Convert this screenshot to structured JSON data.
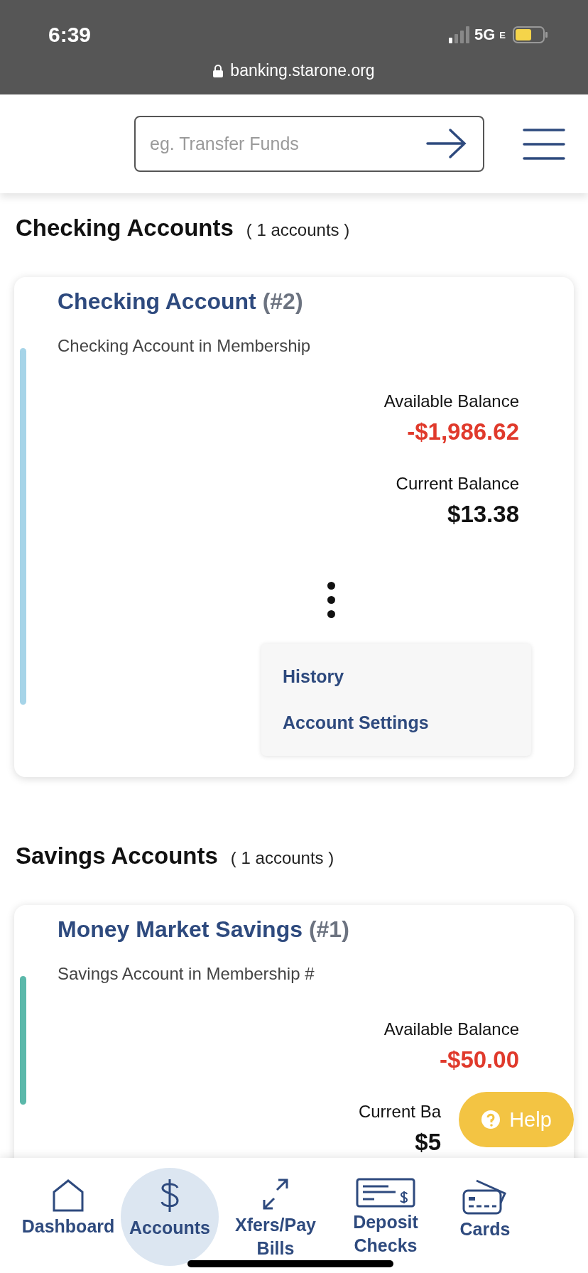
{
  "status_bar": {
    "time": "6:39",
    "network": "5G",
    "network_suffix": "E"
  },
  "browser": {
    "url": "banking.starone.org"
  },
  "header": {
    "search": {
      "placeholder": "eg. Transfer Funds"
    }
  },
  "sections": [
    {
      "title": "Checking Accounts",
      "count": "( 1 accounts )",
      "cards": [
        {
          "title": "Checking Account",
          "number": "(#2)",
          "subtitle": "Checking Account in Membership",
          "color": "#a6d4e8",
          "balances": [
            {
              "label": "Available Balance",
              "amount": "-$1,986.62",
              "negative": true
            },
            {
              "label": "Current Balance",
              "amount": "$13.38",
              "negative": false
            }
          ],
          "menu": {
            "open": true,
            "items": [
              "History",
              "Account Settings"
            ]
          }
        }
      ]
    },
    {
      "title": "Savings Accounts",
      "count": "( 1 accounts )",
      "cards": [
        {
          "title": "Money Market Savings",
          "number": "(#1)",
          "subtitle": "Savings Account in Membership #",
          "color": "#5bb8aa",
          "balances": [
            {
              "label": "Available Balance",
              "amount": "-$50.00",
              "negative": true
            },
            {
              "label": "Current Ba",
              "amount": "$5",
              "negative": false
            }
          ]
        }
      ]
    }
  ],
  "help_button": {
    "label": "Help"
  },
  "bottom_nav": [
    {
      "kind": "home",
      "label": "Dashboard",
      "selected": false
    },
    {
      "kind": "dollar",
      "label": "Accounts",
      "selected": true
    },
    {
      "kind": "transfer",
      "label": "Xfers/Pay Bills",
      "selected": false
    },
    {
      "kind": "check",
      "label": "Deposit Checks",
      "selected": false
    },
    {
      "kind": "cards",
      "label": "Cards",
      "selected": false
    }
  ]
}
